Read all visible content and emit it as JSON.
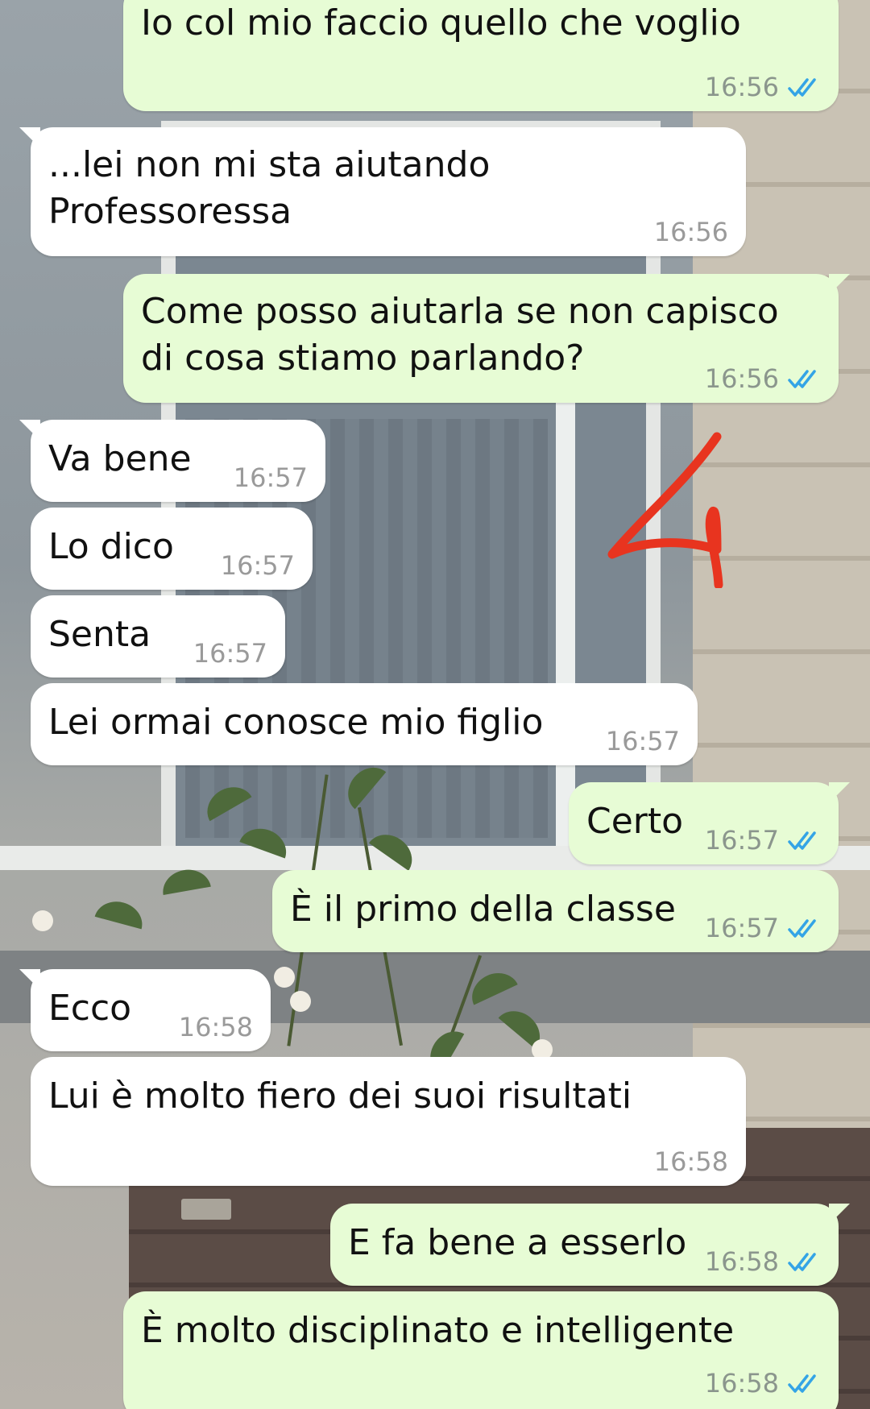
{
  "colors": {
    "incoming_bubble": "#ffffff",
    "outgoing_bubble": "#e7fcd5",
    "read_ticks": "#34a4e6",
    "annotation": "#e8341f"
  },
  "icons": {
    "read_receipt": "double-check-icon",
    "annotation": "red-arrow-annotation"
  },
  "messages": [
    {
      "direction": "out",
      "text": "Io col mio faccio quello che voglio",
      "time": "16:56",
      "read": true
    },
    {
      "direction": "in",
      "text": "...lei non mi sta aiutando\nProfessoressa",
      "time": "16:56"
    },
    {
      "direction": "out",
      "text": "Come posso aiutarla se non capisco\ndi cosa stiamo parlando?",
      "time": "16:56",
      "read": true
    },
    {
      "direction": "in",
      "text": "Va bene",
      "time": "16:57"
    },
    {
      "direction": "in",
      "text": "Lo dico",
      "time": "16:57"
    },
    {
      "direction": "in",
      "text": "Senta",
      "time": "16:57"
    },
    {
      "direction": "in",
      "text": "Lei ormai conosce mio figlio",
      "time": "16:57"
    },
    {
      "direction": "out",
      "text": "Certo",
      "time": "16:57",
      "read": true
    },
    {
      "direction": "out",
      "text": "È il primo della classe",
      "time": "16:57",
      "read": true
    },
    {
      "direction": "in",
      "text": "Ecco",
      "time": "16:58"
    },
    {
      "direction": "in",
      "text": "Lui è molto fiero dei suoi risultati",
      "time": "16:58"
    },
    {
      "direction": "out",
      "text": "E fa bene a esserlo",
      "time": "16:58",
      "read": true
    },
    {
      "direction": "out",
      "text": "È molto disciplinato e intelligente",
      "time": "16:58",
      "read": true
    }
  ]
}
